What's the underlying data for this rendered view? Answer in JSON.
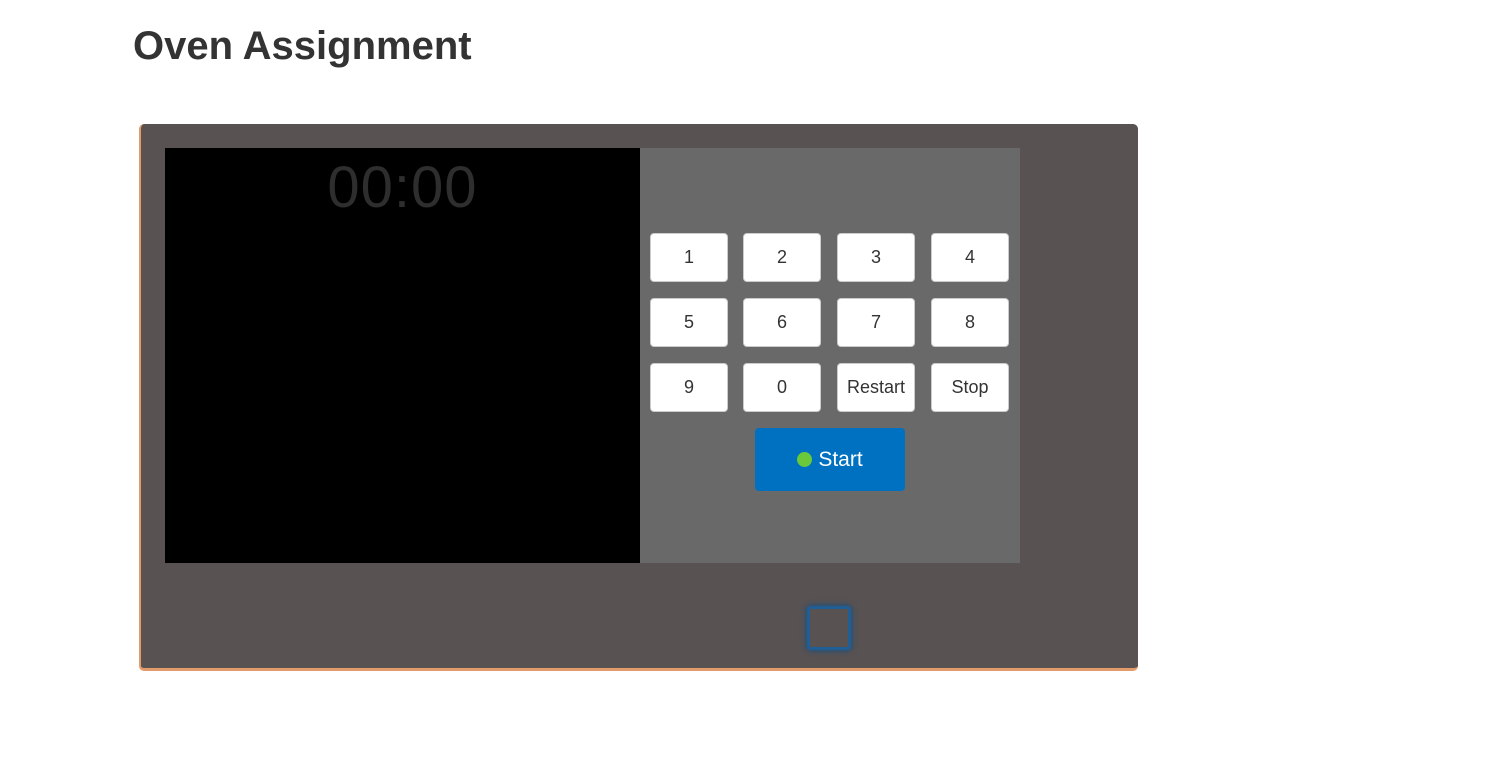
{
  "page": {
    "title": "Oven Assignment"
  },
  "oven": {
    "display": {
      "time": "00:00"
    },
    "keypad": {
      "keys": [
        "1",
        "2",
        "3",
        "4",
        "5",
        "6",
        "7",
        "8",
        "9",
        "0",
        "Restart",
        "Stop"
      ]
    },
    "start": {
      "label": "Start",
      "indicator_color": "#6ac93a"
    },
    "door_handle": {
      "icon": "square-outline-icon"
    }
  },
  "colors": {
    "oven_body": "#585252",
    "oven_trim": "#e39b6b",
    "window": "#000000",
    "control_panel": "#696969",
    "start_button": "#0070c0"
  }
}
